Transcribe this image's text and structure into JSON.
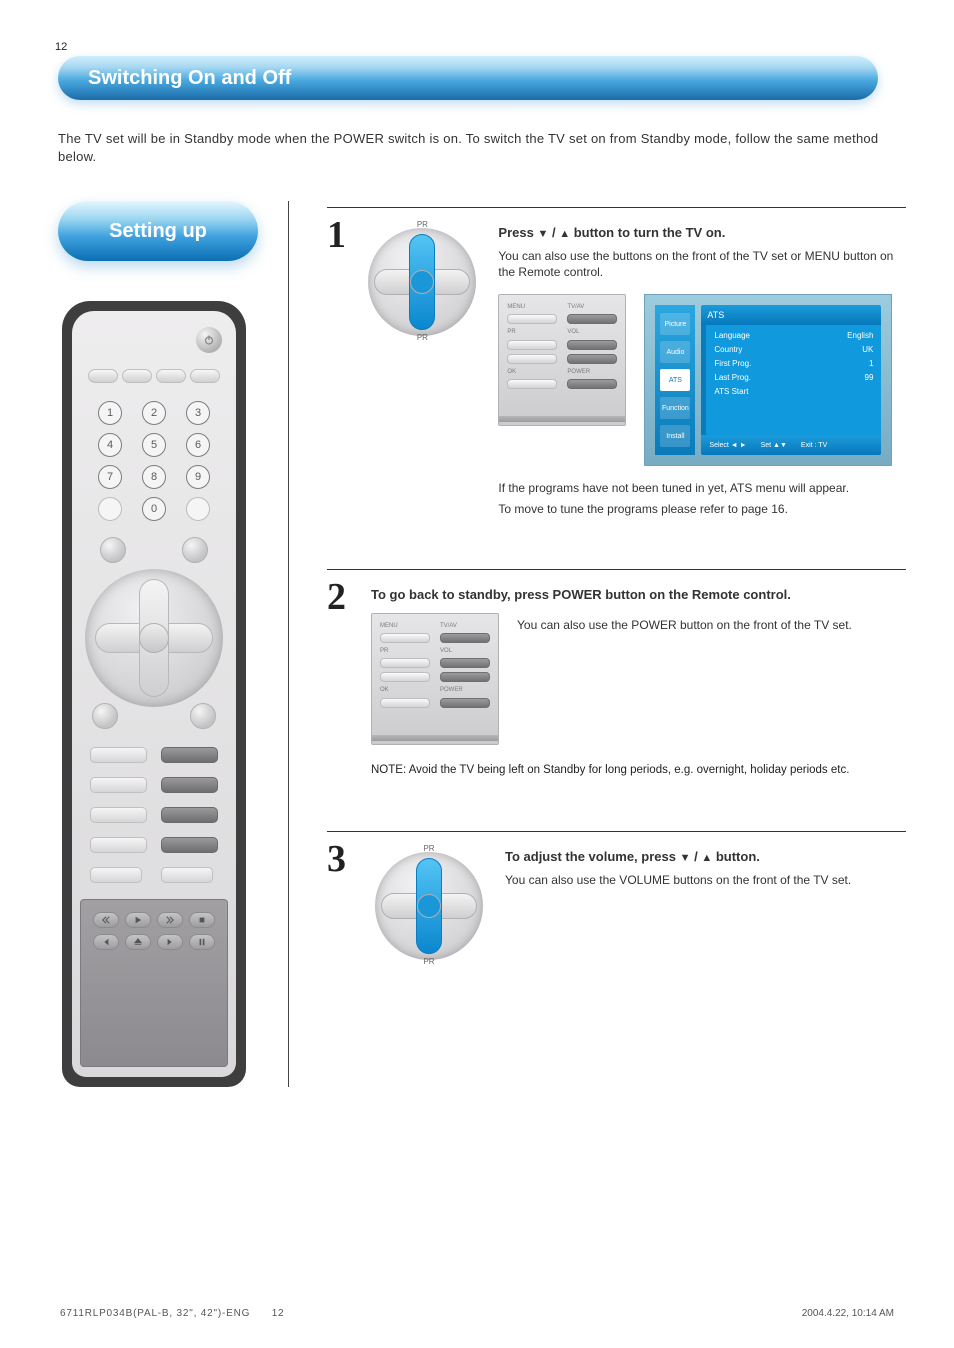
{
  "page_number": "12",
  "title": "Switching On and Off",
  "intro": "The TV set will be in Standby mode when the POWER switch is on. To switch the TV set on from Standby mode, follow the same method below.",
  "pill_heading": "Setting up",
  "steps": [
    {
      "num": "1",
      "title_pre": "Press",
      "title_mid_a": "▼",
      "title_mid_b": "▲",
      "title_post": "button to turn the TV on.",
      "body_paras": [
        "You can also use the buttons on the front of the TV set or MENU button on the Remote control.",
        "If the programs have not been tuned in yet, ATS menu will appear.",
        "To move to tune the programs please refer to page 16."
      ]
    },
    {
      "num": "2",
      "title_pre": "To go back to standby, press POWER button on the Remote control.",
      "body_paras": [
        "You can also use the POWER button on the front of the TV set."
      ],
      "note": "NOTE:  Avoid the TV being left on Standby for long periods, e.g. overnight, holiday periods etc."
    },
    {
      "num": "3",
      "title_pre": "To adjust the volume, press",
      "title_mid_a": "▼",
      "title_mid_b": "▲",
      "title_post": "button.",
      "body_paras": [
        "You can also use the VOLUME buttons on the front of the TV set."
      ]
    }
  ],
  "osd": {
    "tabs": [
      "Picture",
      "Audio",
      "ATS",
      "Function",
      "Install"
    ],
    "active_tab": "ATS",
    "header": "ATS",
    "rows": [
      [
        "Language",
        "English"
      ],
      [
        "Country",
        "UK"
      ],
      [
        "First Prog.",
        "1"
      ],
      [
        "Last Prog.",
        "99"
      ],
      [
        "ATS Start",
        ""
      ]
    ],
    "footer": [
      "Select ◄ ►",
      "Set ▲▼",
      "Exit : TV"
    ]
  },
  "footer_meta": "6711RLP034B(PAL-B, 32\",  42\")-ENG",
  "footer_date": "2004.4.22, 10:14 AM",
  "footer_page": "12"
}
